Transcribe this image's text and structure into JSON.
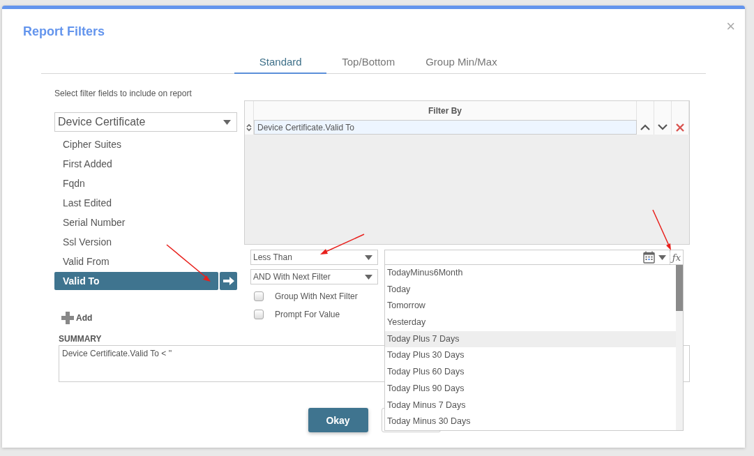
{
  "dialog": {
    "title": "Report Filters",
    "close": "×"
  },
  "tabs": [
    {
      "label": "Standard",
      "selected": true
    },
    {
      "label": "Top/Bottom",
      "selected": false
    },
    {
      "label": "Group Min/Max",
      "selected": false
    }
  ],
  "field_picker": {
    "instruction": "Select filter fields to include on report",
    "entity": "Device Certificate",
    "fields": [
      {
        "label": "Cipher Suites",
        "selected": false
      },
      {
        "label": "First Added",
        "selected": false
      },
      {
        "label": "Fqdn",
        "selected": false
      },
      {
        "label": "Last Edited",
        "selected": false
      },
      {
        "label": "Serial Number",
        "selected": false
      },
      {
        "label": "Ssl Version",
        "selected": false
      },
      {
        "label": "Valid From",
        "selected": false
      },
      {
        "label": "Valid To",
        "selected": true
      }
    ],
    "add_button": "Add"
  },
  "filter_grid": {
    "header": "Filter By",
    "rows": [
      {
        "field": "Device Certificate.Valid To",
        "selected": true
      }
    ]
  },
  "operator": "Less Than",
  "conjunction": "AND With Next Filter",
  "options": [
    {
      "label": "Group With Next Filter",
      "checked": false
    },
    {
      "label": "Prompt For Value",
      "checked": false
    }
  ],
  "value_field": {
    "formula_button": "ƒx"
  },
  "value_list": [
    {
      "label": "TodayMinus6Month",
      "selected": false
    },
    {
      "label": "Today",
      "selected": false
    },
    {
      "label": "Tomorrow",
      "selected": false
    },
    {
      "label": "Yesterday",
      "selected": false
    },
    {
      "label": "Today Plus 7 Days",
      "selected": true
    },
    {
      "label": "Today Plus 30 Days",
      "selected": false
    },
    {
      "label": "Today Plus 60 Days",
      "selected": false
    },
    {
      "label": "Today Plus 90 Days",
      "selected": false
    },
    {
      "label": "Today Minus 7 Days",
      "selected": false
    },
    {
      "label": "Today Minus 30 Days",
      "selected": false
    }
  ],
  "summary": {
    "label": "SUMMARY",
    "text": "Device Certificate.Valid To < ''"
  },
  "buttons": [
    {
      "label": "Okay"
    }
  ]
}
